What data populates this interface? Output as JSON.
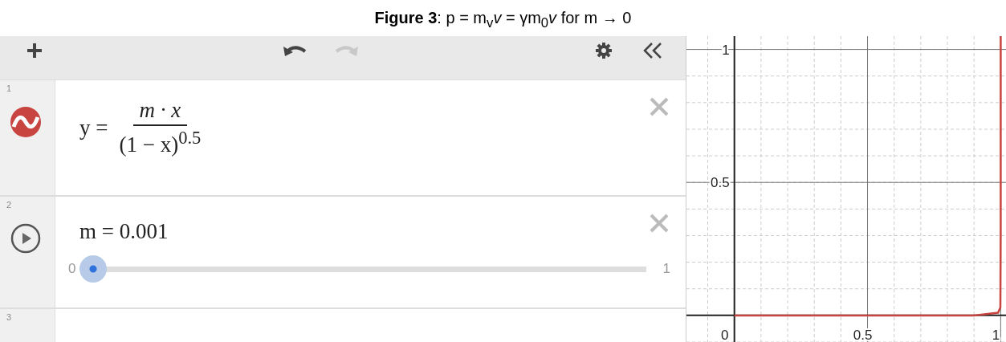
{
  "caption": "**Figure 3**: p = m$_{v}$*v* = γm$_{0}$*v* for m  → 0",
  "toolbar": [
    {
      "kind": "add",
      "disabled": false
    },
    {
      "kind": "undo",
      "disabled": false
    },
    {
      "kind": "redo",
      "disabled": true
    },
    {
      "kind": "settings",
      "disabled": false
    },
    {
      "kind": "collapse",
      "disabled": false
    }
  ],
  "expressions": [
    {
      "kind": "function",
      "number": "1",
      "color": "#c74440",
      "lhs": "y =",
      "numerator": "m · x",
      "denominator": "(1 − x)$^{0.5}$"
    },
    {
      "kind": "slider",
      "number": "2",
      "text": "m = 0.001",
      "min": "0",
      "max": "1",
      "level": 0.001
    },
    {
      "kind": "empty",
      "number": "3"
    }
  ],
  "graph": {
    "chart_data": {
      "type": "line",
      "grid": true,
      "x": [
        0,
        0.5,
        0.9,
        0.99,
        0.999,
        0.99999,
        0.999999,
        0.9999991
      ],
      "series": [
        {
          "color": "#c74440",
          "values": [
            0,
            0,
            0,
            0.01,
            0.03,
            0.32,
            1.0,
            1.05
          ]
        }
      ],
      "xlim": [
        -0.18,
        1.02
      ],
      "ylim": [
        -0.1,
        1.05
      ],
      "xticks": [
        0,
        0.5,
        1
      ],
      "yticks": [
        0.5,
        1
      ]
    }
  }
}
